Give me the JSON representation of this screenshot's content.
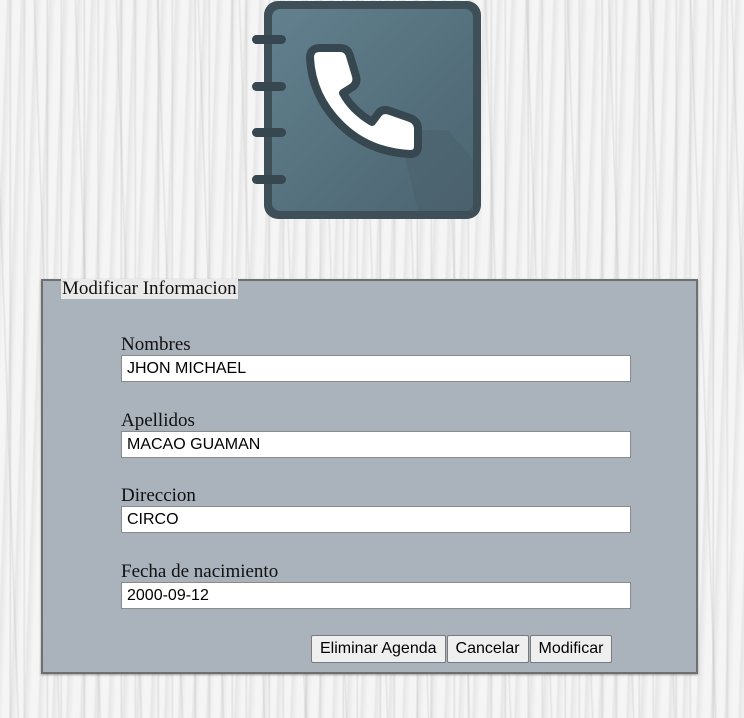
{
  "form": {
    "legend": "Modificar Informacion",
    "fields": [
      {
        "label": "Nombres",
        "value": "JHON MICHAEL"
      },
      {
        "label": "Apellidos",
        "value": "MACAO GUAMAN"
      },
      {
        "label": "Direccion",
        "value": "CIRCO"
      },
      {
        "label": "Fecha de nacimiento",
        "value": "2000-09-12"
      }
    ],
    "buttons": {
      "delete_label": "Eliminar Agenda",
      "cancel_label": "Cancelar",
      "modify_label": "Modificar"
    }
  },
  "logo": {
    "icon": "address-book-phone-icon",
    "colors": {
      "cover": "#546e7a",
      "border": "#37474f",
      "phone": "#ffffff",
      "rings": "#37474f"
    }
  },
  "colors": {
    "panel_background": "#aab2bb",
    "page_background": "#ebebeb"
  }
}
